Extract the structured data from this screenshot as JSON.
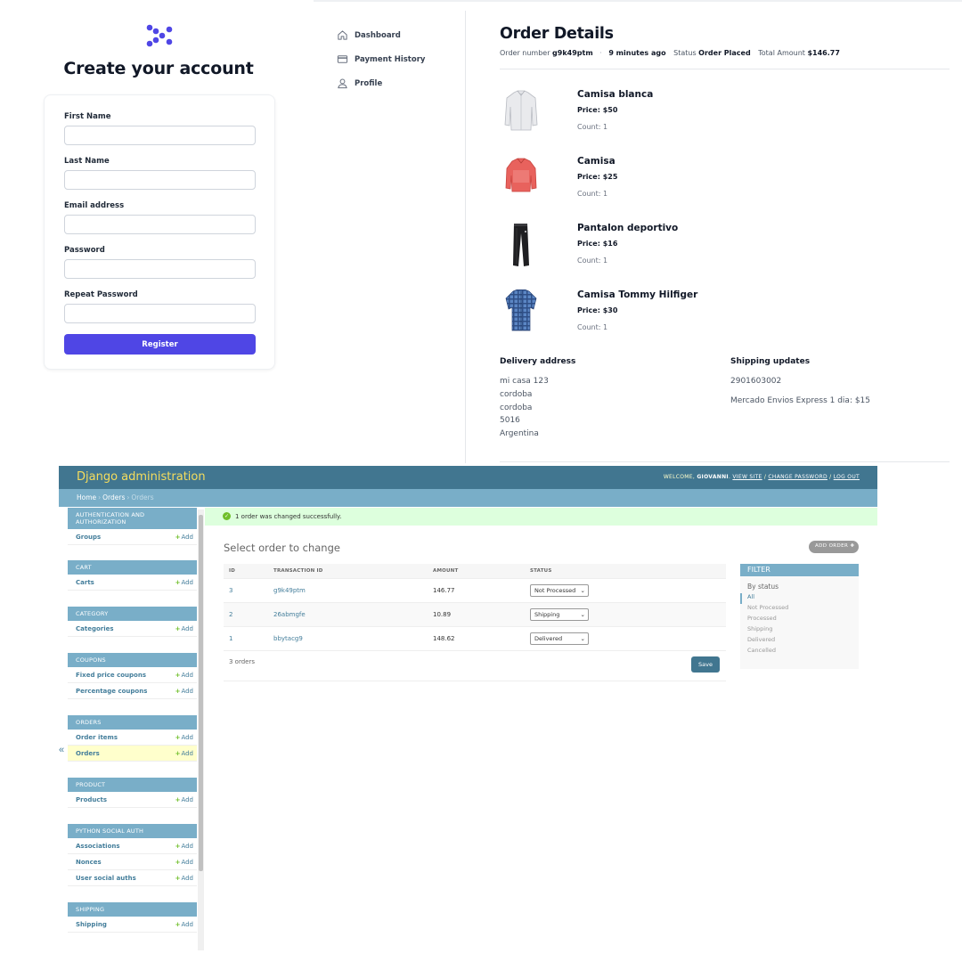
{
  "signup": {
    "title": "Create your account",
    "fields": [
      {
        "label": "First Name",
        "value": ""
      },
      {
        "label": "Last Name",
        "value": ""
      },
      {
        "label": "Email address",
        "value": ""
      },
      {
        "label": "Password",
        "value": ""
      },
      {
        "label": "Repeat Password",
        "value": ""
      }
    ],
    "register_label": "Register",
    "accent": "#4f46e5"
  },
  "order_panel": {
    "nav": [
      {
        "label": "Dashboard",
        "icon": "home-icon"
      },
      {
        "label": "Payment History",
        "icon": "credit-card-icon"
      },
      {
        "label": "Profile",
        "icon": "user-icon"
      }
    ],
    "title": "Order Details",
    "meta": {
      "order_number_label": "Order number",
      "order_number": "g9k49ptm",
      "time": "9 minutes ago",
      "status_label": "Status",
      "status": "Order Placed",
      "total_label": "Total Amount",
      "total": "$146.77"
    },
    "items": [
      {
        "name": "Camisa blanca",
        "price": "Price: $50",
        "count": "Count: 1",
        "image": "white-shirt-image"
      },
      {
        "name": "Camisa",
        "price": "Price: $25",
        "count": "Count: 1",
        "image": "red-shirt-image"
      },
      {
        "name": "Pantalon deportivo",
        "price": "Price: $16",
        "count": "Count: 1",
        "image": "black-pants-image"
      },
      {
        "name": "Camisa Tommy Hilfiger",
        "price": "Price: $30",
        "count": "Count: 1",
        "image": "plaid-shirt-image"
      }
    ],
    "delivery": {
      "title": "Delivery address",
      "lines": [
        "mi casa 123",
        "cordoba",
        "cordoba",
        "5016",
        "Argentina"
      ]
    },
    "shipping": {
      "title": "Shipping updates",
      "lines": [
        "2901603002",
        "Mercado Envios Express 1 dia: $15"
      ]
    }
  },
  "django": {
    "brand": "Django administration",
    "usertools": {
      "welcome": "WELCOME,",
      "user": "GIOVANNI",
      "view_site": "VIEW SITE",
      "change_password": "CHANGE PASSWORD",
      "logout": "LOG OUT"
    },
    "breadcrumbs": [
      "Home",
      "Orders",
      "Orders"
    ],
    "sidebar": [
      {
        "caption": "AUTHENTICATION AND AUTHORIZATION",
        "models": [
          "Groups"
        ]
      },
      {
        "caption": "CART",
        "models": [
          "Carts"
        ]
      },
      {
        "caption": "CATEGORY",
        "models": [
          "Categories"
        ]
      },
      {
        "caption": "COUPONS",
        "models": [
          "Fixed price coupons",
          "Percentage coupons"
        ]
      },
      {
        "caption": "ORDERS",
        "models": [
          "Order items",
          "Orders"
        ]
      },
      {
        "caption": "PRODUCT",
        "models": [
          "Products"
        ]
      },
      {
        "caption": "PYTHON SOCIAL AUTH",
        "models": [
          "Associations",
          "Nonces",
          "User social auths"
        ]
      },
      {
        "caption": "SHIPPING",
        "models": [
          "Shipping"
        ]
      }
    ],
    "add_label": "Add",
    "message": "1 order was changed successfully.",
    "content_title": "Select order to change",
    "add_order_label": "ADD ORDER",
    "columns": [
      "ID",
      "TRANSACTION ID",
      "AMOUNT",
      "STATUS"
    ],
    "rows": [
      {
        "id": "3",
        "transaction_id": "g9k49ptm",
        "amount": "146.77",
        "status": "Not Processed"
      },
      {
        "id": "2",
        "transaction_id": "26abmgfe",
        "amount": "10.89",
        "status": "Shipping"
      },
      {
        "id": "1",
        "transaction_id": "bbytacg9",
        "amount": "148.62",
        "status": "Delivered"
      }
    ],
    "count_label": "3 orders",
    "save_label": "Save",
    "filter": {
      "title": "FILTER",
      "by_label": "By status",
      "options": [
        "All",
        "Not Processed",
        "Processed",
        "Shipping",
        "Delivered",
        "Cancelled"
      ]
    },
    "colors": {
      "header": "#417690",
      "brand": "#f5dd5d",
      "caption": "#79aec8",
      "link": "#447e9b",
      "success_bg": "#ddffdd"
    }
  }
}
